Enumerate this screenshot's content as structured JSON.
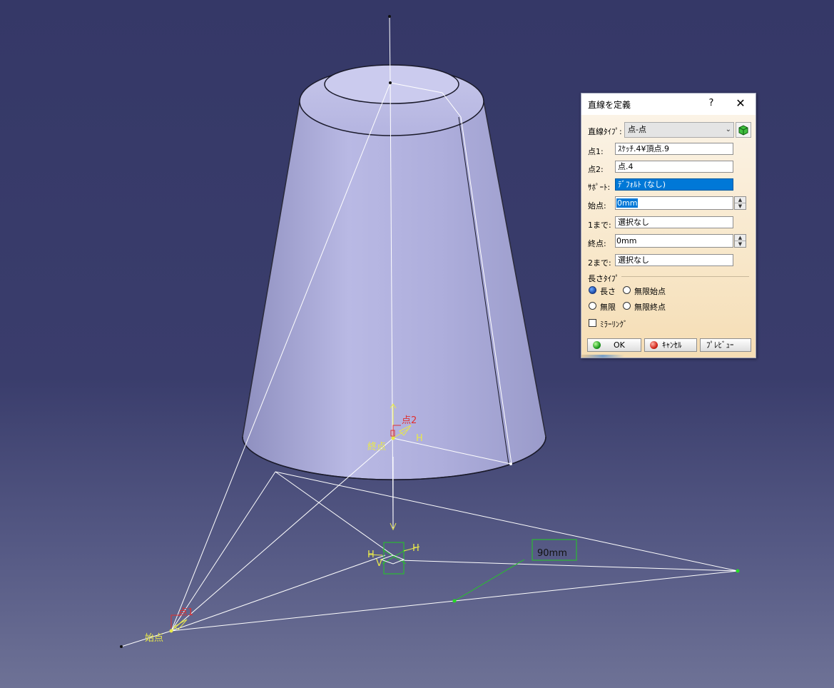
{
  "viewport": {
    "labels": {
      "point2": "点2",
      "point1": "点1",
      "end": "終点",
      "start": "始点",
      "h_top": "H",
      "h_center_left": "H",
      "h_center_right": "H",
      "v_center": "V",
      "dimension": "90mm"
    },
    "colors": {
      "background": "#383b69",
      "cone_fill": "#a8a9d6",
      "wire": "#ffffff",
      "annotation": "#e8e84a",
      "point_label": "#e03030",
      "constraint": "#22cc22"
    }
  },
  "dialog": {
    "title": "直線を定義",
    "help": "?",
    "close": "✕",
    "line_type_label": "直線ﾀｲﾌﾟ:",
    "line_type_value": "点-点",
    "point1_label": "点1:",
    "point1_value": "ｽｹｯﾁ.4¥頂点.9",
    "point2_label": "点2:",
    "point2_value": "点.4",
    "support_label": "ｻﾎﾟｰﾄ:",
    "support_value": "ﾃﾞﾌｫﾙﾄ (なし)",
    "start_label": "始点:",
    "start_value": "0mm",
    "upto1_label": "1まで:",
    "upto1_value": "選択なし",
    "end_label": "終点:",
    "end_value": "0mm",
    "upto2_label": "2まで:",
    "upto2_value": "選択なし",
    "length_type_label": "長さﾀｲﾌﾟ",
    "radio_length": "長さ",
    "radio_infinite_start": "無限始点",
    "radio_infinite": "無限",
    "radio_infinite_end": "無限終点",
    "mirroring_label": "ﾐﾗｰﾘﾝｸﾞ",
    "ok_label": "OK",
    "cancel_label": "ｷｬﾝｾﾙ",
    "preview_label": "ﾌﾟﾚﾋﾞｭｰ"
  }
}
